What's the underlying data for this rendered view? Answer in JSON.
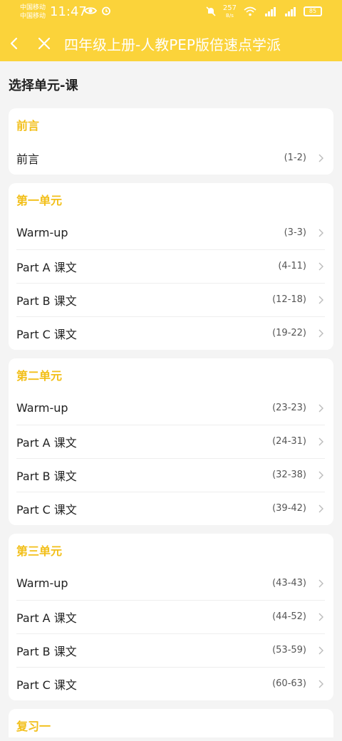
{
  "status_bar": {
    "carrier_1": "中国移动",
    "carrier_2": "中国移动",
    "time": "11:47",
    "net_speed": "257",
    "net_unit": "B/s",
    "battery": "85",
    "icons": [
      "eye-icon",
      "alarm-icon",
      "mute-icon",
      "wifi-icon",
      "signal-icon",
      "battery-icon"
    ]
  },
  "nav": {
    "title": "四年级上册-人教PEP版倍速点学派",
    "back_icon": "chevron-left-icon",
    "close_icon": "close-icon"
  },
  "section_heading": "选择单元-课",
  "units": [
    {
      "title": "前言",
      "items": [
        {
          "title": "前言",
          "range": "(1-2)"
        }
      ]
    },
    {
      "title": "第一单元",
      "items": [
        {
          "title": "Warm-up",
          "range": "(3-3)"
        },
        {
          "title": "Part A 课文",
          "range": "(4-11)"
        },
        {
          "title": "Part B 课文",
          "range": "(12-18)"
        },
        {
          "title": "Part C 课文",
          "range": "(19-22)"
        }
      ]
    },
    {
      "title": "第二单元",
      "items": [
        {
          "title": "Warm-up",
          "range": "(23-23)"
        },
        {
          "title": "Part A 课文",
          "range": "(24-31)"
        },
        {
          "title": "Part B 课文",
          "range": "(32-38)"
        },
        {
          "title": "Part C 课文",
          "range": "(39-42)"
        }
      ]
    },
    {
      "title": "第三单元",
      "items": [
        {
          "title": "Warm-up",
          "range": "(43-43)"
        },
        {
          "title": "Part A 课文",
          "range": "(44-52)"
        },
        {
          "title": "Part B 课文",
          "range": "(53-59)"
        },
        {
          "title": "Part C 课文",
          "range": "(60-63)"
        }
      ]
    },
    {
      "title": "复习一",
      "items": []
    }
  ],
  "colors": {
    "accent": "#fbd33a",
    "unit_title": "#f2bf19",
    "background": "#f4f4f4"
  }
}
